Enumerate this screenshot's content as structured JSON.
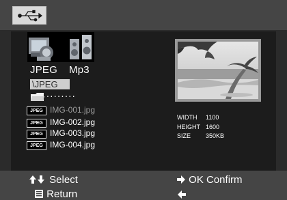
{
  "header": {
    "usb_icon": "usb-icon"
  },
  "media_types": {
    "items": [
      {
        "label": "JPEG",
        "icon": "photo-camera-icon",
        "selected": true
      },
      {
        "label": "Mp3",
        "icon": "speakers-icon",
        "selected": false
      }
    ]
  },
  "browser": {
    "current_dir": "\\JPEG",
    "parent_folder_dots": "........",
    "files": [
      {
        "tag": "JPEG",
        "name": "IMG-001.jpg",
        "selected": true
      },
      {
        "tag": "JPEG",
        "name": "IMG-002.jpg",
        "selected": false
      },
      {
        "tag": "JPEG",
        "name": "IMG-003.jpg",
        "selected": false
      },
      {
        "tag": "JPEG",
        "name": "IMG-004.jpg",
        "selected": false
      }
    ]
  },
  "preview": {
    "image_icon": "beach-photo-thumbnail",
    "width_label": "WIDTH",
    "width_value": "1100",
    "height_label": "HEIGHT",
    "height_value": "1600",
    "size_label": "SIZE",
    "size_value": "350KB"
  },
  "footer": {
    "select": "Select",
    "ok_confirm": "OK Confirm",
    "return": "Return",
    "icons": [
      "up-down-arrows-icon",
      "right-arrow-icon",
      "menu-icon",
      "left-arrow-icon"
    ]
  },
  "colors": {
    "bar": "#454545",
    "panel": "#1c1c1c",
    "selection": "#cfcfcf",
    "text": "#ffffff"
  }
}
